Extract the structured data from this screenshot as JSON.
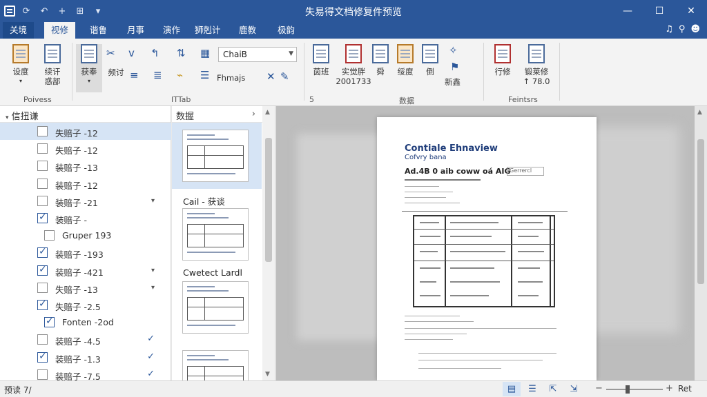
{
  "window": {
    "title": "失易得文档修复件预览",
    "controls": {
      "minimize": "—",
      "maximize": "☐",
      "close": "✕"
    }
  },
  "quick_access": [
    "↶",
    "+",
    "⊞",
    "▾"
  ],
  "tabs": [
    {
      "label": "关境"
    },
    {
      "label": "视修"
    },
    {
      "label": "谐鲁"
    },
    {
      "label": "月事"
    },
    {
      "label": "演作"
    },
    {
      "label": "狮剋计"
    },
    {
      "label": "鹿教"
    },
    {
      "label": "极韵"
    }
  ],
  "tab_right_icons": [
    "♫",
    "⚲",
    "☻"
  ],
  "ribbon": {
    "buttons": {
      "b1": "设度",
      "b2a": "续讦",
      "b2b": "惑部",
      "b3": "获奉",
      "b4": "频讨",
      "b5": "茵班",
      "b6a": "实觉胖",
      "b6b": "2001733",
      "b7": "舜",
      "b8": "绥度",
      "b9": "倒",
      "b10": "新鑫",
      "b11": "行修",
      "b12a": "锻莱修",
      "b12b": "↑ 78.0"
    },
    "font_combo": "ChaiB",
    "font_style": "Fhmajs",
    "groups": [
      "Poivess",
      "ITTab",
      "5",
      "数据",
      "Feintsrs"
    ]
  },
  "left_pane": {
    "header": "信扭谦",
    "items": [
      {
        "label": "失赔子 -12",
        "checked": false,
        "selected": true,
        "end": ""
      },
      {
        "label": "失赔子 -12",
        "checked": false,
        "selected": false,
        "end": ""
      },
      {
        "label": "装赔子 -13",
        "checked": false,
        "selected": false,
        "end": ""
      },
      {
        "label": "装赔子 -12",
        "checked": false,
        "selected": false,
        "end": ""
      },
      {
        "label": "装赔子 -21",
        "checked": false,
        "selected": false,
        "end": "▾"
      },
      {
        "label": "装赔子 -",
        "checked": true,
        "selected": false,
        "end": ""
      },
      {
        "label": "Gruper 193",
        "checked": false,
        "selected": false,
        "end": "",
        "indent": true
      },
      {
        "label": "装赔子 -193",
        "checked": true,
        "selected": false,
        "end": ""
      },
      {
        "label": "装赔子 -421",
        "checked": true,
        "selected": false,
        "end": "▾"
      },
      {
        "label": "失赔子 -13",
        "checked": false,
        "selected": false,
        "end": "▾"
      },
      {
        "label": "失赔子 -2.5",
        "checked": true,
        "selected": false,
        "end": ""
      },
      {
        "label": "Fonten -2od",
        "checked": true,
        "selected": false,
        "end": "",
        "indent": true
      },
      {
        "label": "装赔子 -4.5",
        "checked": false,
        "selected": false,
        "end": "✓"
      },
      {
        "label": "装赔子 -1.3",
        "checked": true,
        "selected": false,
        "end": "✓"
      },
      {
        "label": "装赔子 -7.5",
        "checked": false,
        "selected": false,
        "end": "✓"
      }
    ]
  },
  "mid_pane": {
    "header": "数握",
    "chevron": "›",
    "thumbs": [
      {
        "title": ""
      },
      {
        "title": "Cail - 获谈"
      },
      {
        "title": "Cwetect Lardl"
      }
    ]
  },
  "preview_page": {
    "title": "Contiale Ehnaview",
    "subtitle": "Cofvry bana",
    "heading": "Ad.4B 0 aib coww oá AIG",
    "tag": "Gerrercl"
  },
  "statusbar": {
    "left": "预读 7/",
    "view_icons": [
      "▤",
      "☰",
      "⇱",
      "⇲"
    ],
    "zoom_label": "Ret"
  }
}
